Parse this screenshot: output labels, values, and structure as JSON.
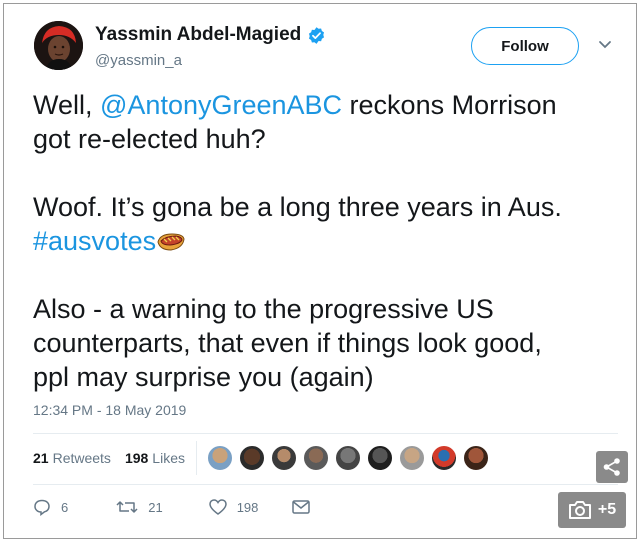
{
  "author": {
    "name": "Yassmin Abdel-Magied",
    "handle": "@yassmin_a",
    "verified": true
  },
  "follow_label": "Follow",
  "tweet": {
    "line1_prefix": "Well, ",
    "mention": "@AntonyGreenABC",
    "line1_suffix": " reckons Morrison",
    "line2": "got re-elected huh?",
    "line3": "Woof. It’s gona be a long three years in Aus.",
    "hashtag": "#ausvotes",
    "line5": "Also - a warning to the progressive US",
    "line6": "counterparts, that even if things look good,",
    "line7": "ppl may surprise you (again)"
  },
  "timestamp": "12:34 PM - 18 May 2019",
  "stats": {
    "retweets_count": "21",
    "retweets_label": "Retweets",
    "likes_count": "198",
    "likes_label": "Likes"
  },
  "actions": {
    "replies": "6",
    "retweets": "21",
    "likes": "198"
  },
  "photo_overlay_label": "+5",
  "colors": {
    "link": "#1b95e0",
    "follow_border": "#1da1f2",
    "muted": "#657786",
    "overlay": "#8a8a8a"
  },
  "icons": [
    "verified-badge-icon",
    "chevron-down-icon",
    "sausage-sizzle-emoji",
    "reply-icon",
    "retweet-icon",
    "heart-icon",
    "message-icon",
    "share-icon",
    "camera-icon"
  ]
}
